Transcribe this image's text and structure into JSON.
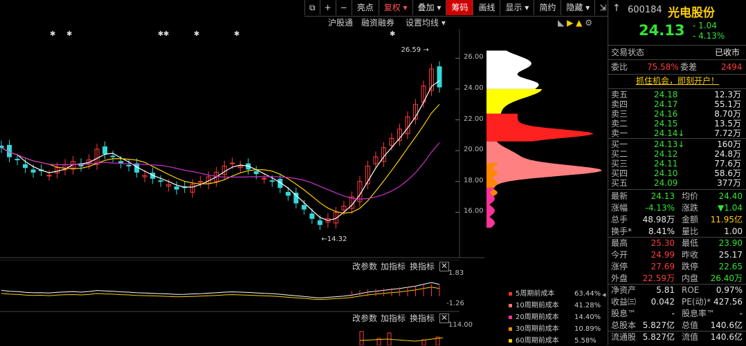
{
  "toolbar": {
    "items": [
      "亮点",
      "复权",
      "叠加",
      "筹码",
      "画线",
      "显示",
      "简约",
      "隐藏"
    ],
    "icons": [
      "copy-icon",
      "plus-icon",
      "minus-icon"
    ],
    "active_index": 3
  },
  "subbar": {
    "links": [
      "沪股通",
      "融资融券",
      "设置均线"
    ]
  },
  "chart": {
    "price_labels": [
      "26.00",
      "24.00",
      "22.00",
      "20.00",
      "18.00",
      "16.00"
    ],
    "high_marker": "26.59",
    "low_marker": "14.32",
    "indicator_top_labels": [
      "改参数",
      "加指标",
      "换指标"
    ],
    "indicator_axis": [
      "1.83",
      "-1.26"
    ],
    "indicator2_labels": [
      "改参数",
      "加指标",
      "换指标"
    ],
    "indicator2_axis": "114.00"
  },
  "chip_legend": [
    {
      "label": "5周期前成本",
      "pct": "63.44%",
      "color": "#ff3030"
    },
    {
      "label": "10周期前成本",
      "pct": "41.28%",
      "color": "#ff7070"
    },
    {
      "label": "20周期前成本",
      "pct": "14.40%",
      "color": "#ff3399"
    },
    {
      "label": "30周期前成本",
      "pct": "10.89%",
      "color": "#ff8800"
    },
    {
      "label": "60周期前成本",
      "pct": "5.58%",
      "color": "#ffcc00"
    }
  ],
  "chart_data": {
    "type": "candlestick",
    "ylim": [
      14,
      27
    ],
    "price_ticks": [
      16,
      18,
      20,
      22,
      24,
      26
    ],
    "high": 26.59,
    "low": 14.32,
    "close_series": [
      20.2,
      19.6,
      19.4,
      18.9,
      18.6,
      18.7,
      18.4,
      18.9,
      19.1,
      19.3,
      19.0,
      19.4,
      20.1,
      19.8,
      19.6,
      19.2,
      19.0,
      18.6,
      18.4,
      18.2,
      18.0,
      17.8,
      17.5,
      17.6,
      17.8,
      18.0,
      18.3,
      18.6,
      19.0,
      19.2,
      19.0,
      18.8,
      18.5,
      18.2,
      18.0,
      17.6,
      17.1,
      16.6,
      16.2,
      15.6,
      15.2,
      15.6,
      16.0,
      16.4,
      17.0,
      18.0,
      19.0,
      19.6,
      20.2,
      20.8,
      21.4,
      22.2,
      23.0,
      24.2,
      25.3,
      24.13
    ]
  },
  "quote": {
    "code": "600184",
    "name": "光电股份",
    "price": "24.13",
    "change": "- 1.04",
    "change_pct": "- 4.13%"
  },
  "status": {
    "label": "交易状态",
    "value": "已收市"
  },
  "weibi": {
    "label1": "委比",
    "value1": "75.58%",
    "label2": "委差",
    "value2": "2494"
  },
  "promo": "抓住机会，即刻开户！",
  "sell": [
    {
      "label": "卖五",
      "price": "24.18",
      "vol": "12.3万"
    },
    {
      "label": "卖四",
      "price": "24.17",
      "vol": "55.1万"
    },
    {
      "label": "卖三",
      "price": "24.16",
      "vol": "8.70万"
    },
    {
      "label": "卖二",
      "price": "24.15",
      "vol": "13.5万"
    },
    {
      "label": "卖一",
      "price": "24.14↓",
      "vol": "7.72万"
    }
  ],
  "buy": [
    {
      "label": "买一",
      "price": "24.13↓",
      "vol": "160万"
    },
    {
      "label": "买二",
      "price": "24.12",
      "vol": "24.8万"
    },
    {
      "label": "买三",
      "price": "24.11",
      "vol": "77.6万"
    },
    {
      "label": "买四",
      "price": "24.10",
      "vol": "58.6万"
    },
    {
      "label": "买五",
      "price": "24.09",
      "vol": "377万"
    }
  ],
  "stats": [
    {
      "l1": "最新",
      "v1": "24.13",
      "c1": "grn",
      "l2": "均价",
      "v2": "24.40",
      "c2": "grn"
    },
    {
      "l1": "涨幅",
      "v1": "-4.13%",
      "c1": "grn",
      "l2": "涨跌",
      "v2": "▼1.04",
      "c2": "grn"
    },
    {
      "l1": "总手",
      "v1": "48.98万",
      "c1": "wht",
      "l2": "金额",
      "v2": "11.95亿",
      "c2": "yel"
    },
    {
      "l1": "换手*",
      "v1": "8.41%",
      "c1": "wht",
      "l2": "量比",
      "v2": "1.00",
      "c2": "wht"
    },
    {
      "l1": "最高",
      "v1": "25.30",
      "c1": "red",
      "l2": "最低",
      "v2": "23.90",
      "c2": "grn"
    },
    {
      "l1": "今开",
      "v1": "24.99",
      "c1": "red",
      "l2": "昨收",
      "v2": "25.17",
      "c2": "wht"
    },
    {
      "l1": "涨停",
      "v1": "27.69",
      "c1": "red",
      "l2": "跌停",
      "v2": "22.65",
      "c2": "grn"
    },
    {
      "l1": "外盘",
      "v1": "22.59万",
      "c1": "red",
      "l2": "内盘",
      "v2": "26.40万",
      "c2": "grn"
    },
    {
      "l1": "净资产",
      "v1": "5.81",
      "c1": "wht",
      "l2": "ROE",
      "v2": "0.97%",
      "c2": "wht"
    },
    {
      "l1": "收益㈢",
      "v1": "0.042",
      "c1": "wht",
      "l2": "PE(动)*",
      "v2": "427.56",
      "c2": "wht"
    },
    {
      "l1": "股息™",
      "v1": "-",
      "c1": "wht",
      "l2": "股息率™",
      "v2": "-",
      "c2": "wht"
    },
    {
      "l1": "总股本",
      "v1": "5.827亿",
      "c1": "wht",
      "l2": "总值",
      "v2": "140.6亿",
      "c2": "wht"
    },
    {
      "l1": "流通股",
      "v1": "5.827亿",
      "c1": "wht",
      "l2": "流值",
      "v2": "140.6亿",
      "c2": "wht"
    }
  ]
}
